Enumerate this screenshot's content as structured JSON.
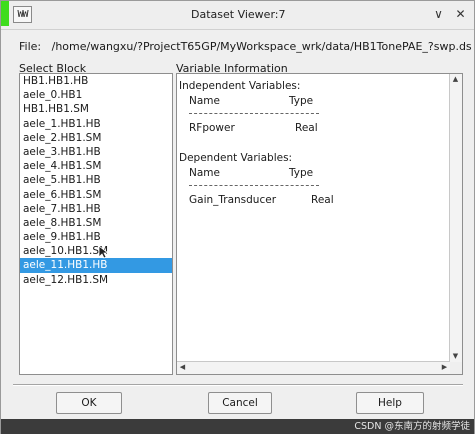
{
  "window": {
    "title": "Dataset Viewer:7",
    "app_icon_text": "WW",
    "accent_color": "#3fdc1e"
  },
  "titlebar_buttons": {
    "minimize_icon": "chevron-down-icon",
    "minimize_glyph": "∨",
    "close_icon": "close-icon",
    "close_glyph": "✕"
  },
  "file": {
    "label": "File:",
    "path": "/home/wangxu/?ProjectT65GP/MyWorkspace_wrk/data/HB1TonePAE_?swp.ds"
  },
  "select_block": {
    "label": "Select Block",
    "items": [
      "HB1.HB1.HB",
      "aele_0.HB1",
      "HB1.HB1.SM",
      "aele_1.HB1.HB",
      "aele_2.HB1.SM",
      "aele_3.HB1.HB",
      "aele_4.HB1.SM",
      "aele_5.HB1.HB",
      "aele_6.HB1.SM",
      "aele_7.HB1.HB",
      "aele_8.HB1.SM",
      "aele_9.HB1.HB",
      "aele_10.HB1.SM",
      "aele_11.HB1.HB",
      "aele_12.HB1.SM"
    ],
    "selected_index": 13,
    "selected_color": "#3399e3"
  },
  "variable_info": {
    "label": "Variable Information",
    "independent_heading": "Independent Variables:",
    "dependent_heading": "Dependent Variables:",
    "col_name": "Name",
    "col_type": "Type",
    "separator": "--------------------------------------------",
    "independent": [
      {
        "name": "RFpower",
        "type": "Real"
      }
    ],
    "dependent": [
      {
        "name": "Gain_Transducer",
        "type": "Real"
      }
    ]
  },
  "buttons": {
    "ok": "OK",
    "cancel": "Cancel",
    "help": "Help"
  },
  "watermark": "CSDN @东南方的射频学徒"
}
